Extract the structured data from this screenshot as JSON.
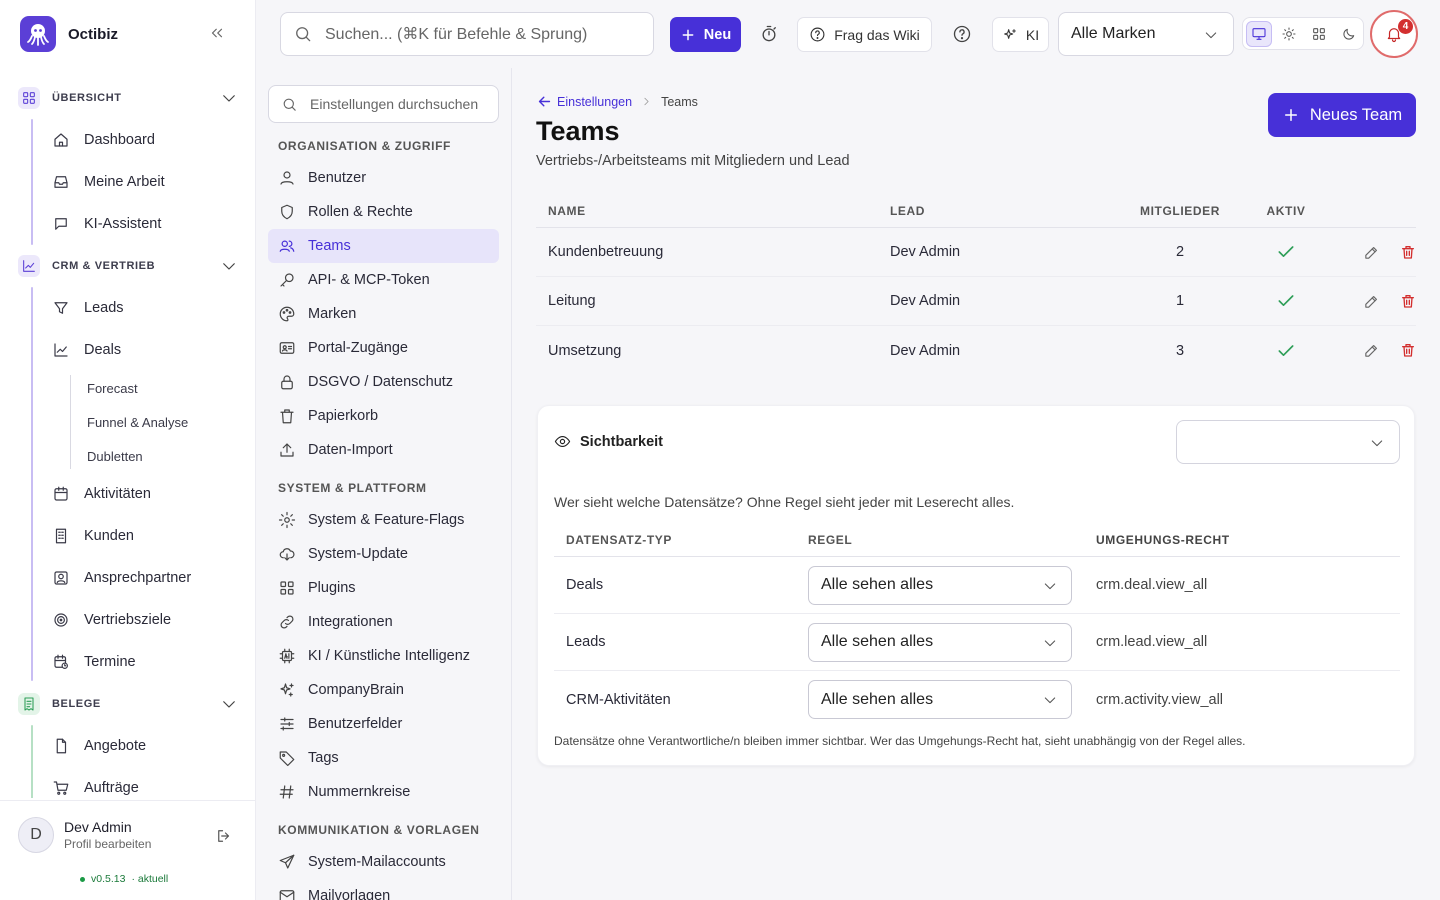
{
  "app": {
    "name": "Octibiz"
  },
  "sidebar": {
    "sections": [
      {
        "label": "ÜBERSICHT",
        "items": [
          "Dashboard",
          "Meine Arbeit",
          "KI-Assistent"
        ]
      },
      {
        "label": "CRM & VERTRIEB",
        "items": [
          "Leads",
          "Deals",
          "Aktivitäten",
          "Kunden",
          "Ansprechpartner",
          "Vertriebsziele",
          "Termine"
        ],
        "subitems": [
          "Forecast",
          "Funnel & Analyse",
          "Dubletten"
        ]
      },
      {
        "label": "BELEGE",
        "items": [
          "Angebote",
          "Aufträge"
        ]
      }
    ],
    "colors": {
      "overview": "#5b3fd6",
      "crm": "#7b5be6",
      "belege": "#2e9e58"
    }
  },
  "user": {
    "name": "Dev Admin",
    "initial": "D",
    "profile_link": "Profil bearbeiten",
    "version": "v0.5.13",
    "version_status": "· aktuell"
  },
  "topbar": {
    "search_placeholder": "Suchen... (⌘K für Befehle & Sprung)",
    "new_label": "Neu",
    "wiki_label": "Frag das Wiki",
    "ki_label": "KI",
    "brand_select": "Alle Marken",
    "notifications_count": "4"
  },
  "settings_nav": {
    "search_placeholder": "Einstellungen durchsuchen",
    "groups": [
      {
        "label": "ORGANISATION & ZUGRIFF",
        "items": [
          "Benutzer",
          "Rollen & Rechte",
          "Teams",
          "API- & MCP-Token",
          "Marken",
          "Portal-Zugänge",
          "DSGVO / Datenschutz",
          "Papierkorb",
          "Daten-Import"
        ]
      },
      {
        "label": "SYSTEM & PLATTFORM",
        "items": [
          "System & Feature-Flags",
          "System-Update",
          "Plugins",
          "Integrationen",
          "KI / Künstliche Intelligenz",
          "CompanyBrain",
          "Benutzerfelder",
          "Tags",
          "Nummernkreise"
        ]
      },
      {
        "label": "KOMMUNIKATION & VORLAGEN",
        "items": [
          "System-Mailaccounts",
          "Mailvorlagen"
        ]
      }
    ],
    "active": "Teams"
  },
  "page": {
    "breadcrumb_back": "Einstellungen",
    "breadcrumb_current": "Teams",
    "title": "Teams",
    "subtitle": "Vertriebs-/Arbeitsteams mit Mitgliedern und Lead",
    "new_button": "Neues Team",
    "columns": [
      "NAME",
      "LEAD",
      "MITGLIEDER",
      "AKTIV"
    ],
    "teams": [
      {
        "name": "Kundenbetreuung",
        "lead": "Dev Admin",
        "members": "2",
        "active": true
      },
      {
        "name": "Leitung",
        "lead": "Dev Admin",
        "members": "1",
        "active": true
      },
      {
        "name": "Umsetzung",
        "lead": "Dev Admin",
        "members": "3",
        "active": true
      }
    ]
  },
  "visibility": {
    "title": "Sichtbarkeit",
    "select_value": "",
    "description": "Wer sieht welche Datensätze? Ohne Regel sieht jeder mit Leserecht alles.",
    "columns": [
      "DATENSATZ-TYP",
      "REGEL",
      "UMGEHUNGS-RECHT"
    ],
    "rows": [
      {
        "type": "Deals",
        "rule": "Alle sehen alles",
        "bypass": "crm.deal.view_all"
      },
      {
        "type": "Leads",
        "rule": "Alle sehen alles",
        "bypass": "crm.lead.view_all"
      },
      {
        "type": "CRM-Aktivitäten",
        "rule": "Alle sehen alles",
        "bypass": "crm.activity.view_all"
      }
    ],
    "footnote": "Datensätze ohne Verantwortliche/n bleiben immer sichtbar. Wer das Umgehungs-Recht hat, sieht unabhängig von der Regel alles."
  },
  "colors": {
    "accent": "#4730d8",
    "success": "#2e9e58",
    "danger": "#d32f2f"
  }
}
